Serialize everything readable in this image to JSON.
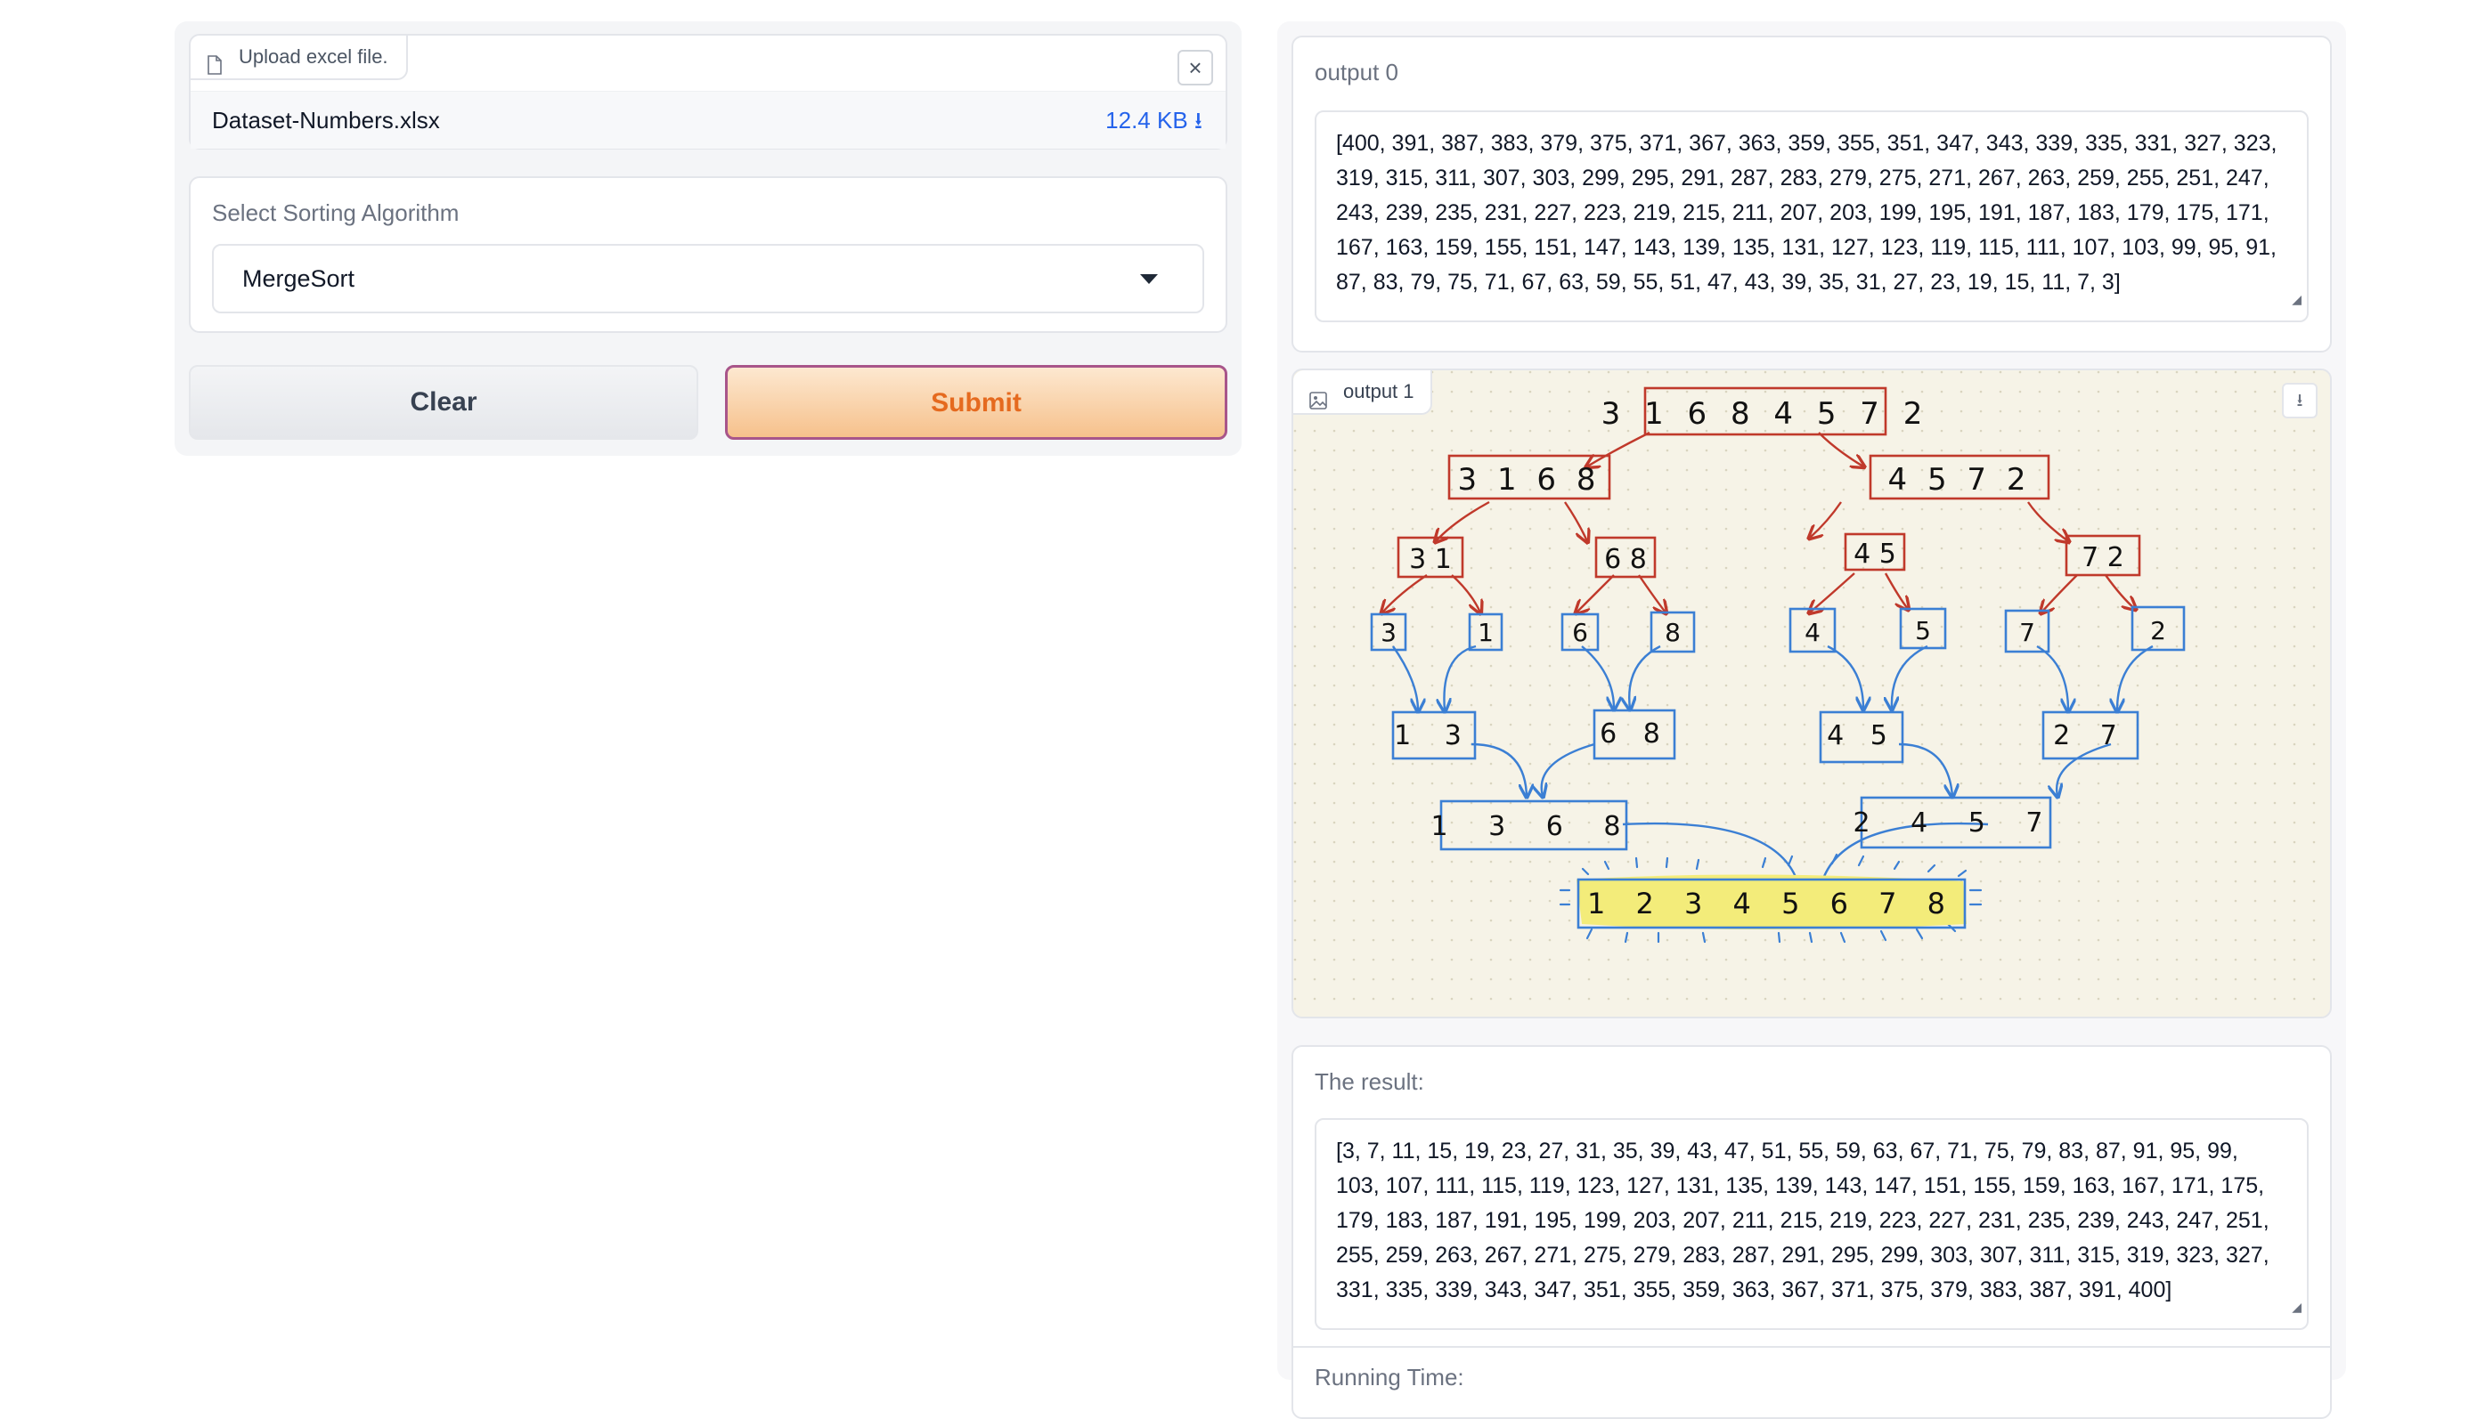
{
  "upload": {
    "label": "Upload excel file.",
    "file_name": "Dataset-Numbers.xlsx",
    "file_size": "12.4 KB ⭳",
    "clear_icon": "×"
  },
  "select": {
    "label": "Select Sorting Algorithm",
    "value": "MergeSort"
  },
  "buttons": {
    "clear": "Clear",
    "submit": "Submit"
  },
  "output0": {
    "label": "output 0",
    "value": "[400, 391, 387, 383, 379, 375, 371, 367, 363, 359, 355, 351, 347, 343, 339, 335, 331, 327, 323, 319, 315, 311, 307, 303, 299, 295, 291, 287, 283, 279, 275, 271, 267, 263, 259, 255, 251, 247, 243, 239, 235, 231, 227, 223, 219, 215, 211, 207, 203, 199, 195, 191, 187, 183, 179, 175, 171, 167, 163, 159, 155, 151, 147, 143, 139, 135, 131, 127, 123, 119, 115, 111, 107, 103, 99, 95, 91, 87, 83, 79, 75, 71, 67, 63, 59, 55, 51, 47, 43, 39, 35, 31, 27, 23, 19, 15, 11, 7, 3]"
  },
  "output1": {
    "label": "output 1",
    "tree": {
      "root": "3 1 6 8 4 5 7 2",
      "split1": [
        "3 1 6 8",
        "4 5 7 2"
      ],
      "split2": [
        "3 1",
        "6 8",
        "4 5",
        "7 2"
      ],
      "leaves": [
        "3",
        "1",
        "6",
        "8",
        "4",
        "5",
        "7",
        "2"
      ],
      "merge1": [
        "1 3",
        "6 8",
        "4 5",
        "2 7"
      ],
      "merge2": [
        "1 3 6 8",
        "2 4 5 7"
      ],
      "final": "1 2 3 4 5 6 7 8"
    }
  },
  "result": {
    "label": "The result:",
    "value": "[3, 7, 11, 15, 19, 23, 27, 31, 35, 39, 43, 47, 51, 55, 59, 63, 67, 71, 75, 79, 83, 87, 91, 95, 99, 103, 107, 111, 115, 119, 123, 127, 131, 135, 139, 143, 147, 151, 155, 159, 163, 167, 171, 175, 179, 183, 187, 191, 195, 199, 203, 207, 211, 215, 219, 223, 227, 231, 235, 239, 243, 247, 251, 255, 259, 263, 267, 271, 275, 279, 283, 287, 291, 295, 299, 303, 307, 311, 315, 319, 323, 327, 331, 335, 339, 343, 347, 351, 355, 359, 363, 367, 371, 375, 379, 383, 387, 391, 400]"
  },
  "running_time": {
    "label": "Running Time:"
  },
  "colors": {
    "submit_text": "#e56a1f",
    "split_red": "#c0392b",
    "merge_blue": "#3b7fd4",
    "highlight": "#f3ec7a"
  }
}
